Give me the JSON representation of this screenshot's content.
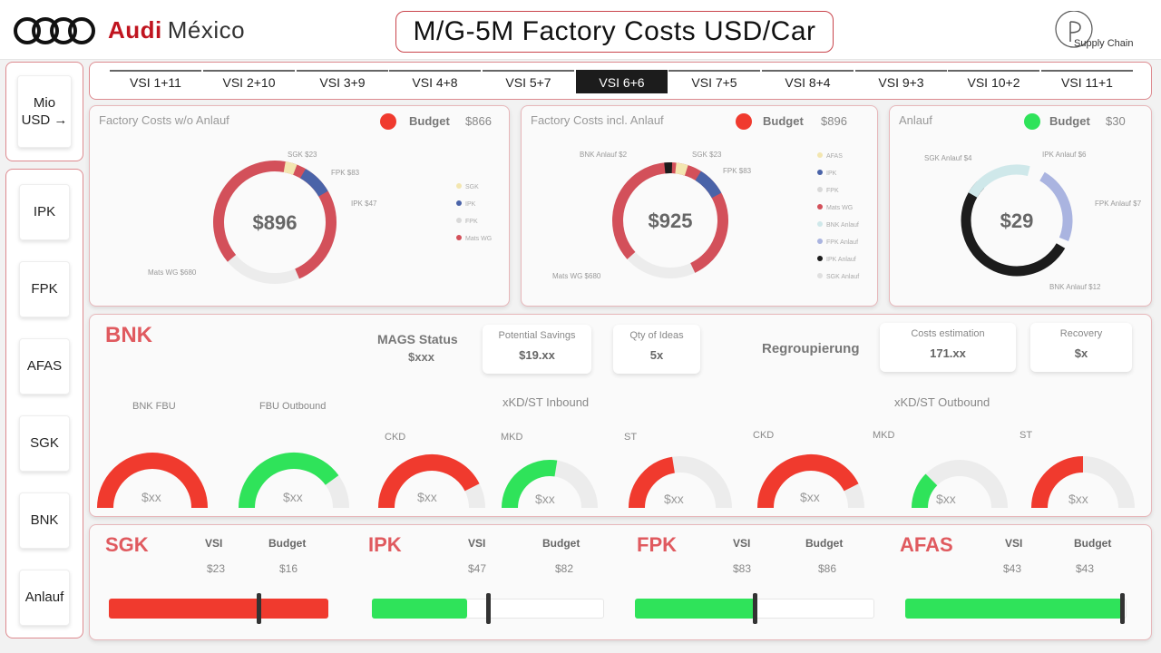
{
  "header": {
    "brand_audi": "Audi",
    "brand_location": "México",
    "title": "M/G-5M Factory Costs USD/Car",
    "logo_text": "Supply Chain"
  },
  "unit_toggle": {
    "label": "Mio USD →"
  },
  "nav": {
    "items": [
      "IPK",
      "FPK",
      "AFAS",
      "SGK",
      "BNK",
      "Anlauf"
    ]
  },
  "tabs": {
    "items": [
      "VSI 1+11",
      "VSI 2+10",
      "VSI 3+9",
      "VSI 4+8",
      "VSI 5+7",
      "VSI 6+6",
      "VSI 7+5",
      "VSI 8+4",
      "VSI 9+3",
      "VSI 10+2",
      "VSI 11+1"
    ],
    "active": "VSI 6+6"
  },
  "colors": {
    "accent_red": "#c0141f",
    "status_red": "#f03a2e",
    "status_green": "#2fe35a",
    "donut_red": "#d3505a",
    "donut_blue": "#4a63a8",
    "donut_black": "#1c1c1c",
    "donut_lavender": "#aab4e0",
    "donut_teal": "#cfe8ea"
  },
  "panels": {
    "factory_costs_wo": {
      "title": "Factory Costs w/o Anlauf",
      "budget_label": "Budget",
      "budget_value": "$866",
      "status": "red",
      "center_value": "$896",
      "slice_labels": [
        "SGK $23",
        "FPK $83",
        "IPK $47",
        "Mats WG $680"
      ],
      "legend": [
        "SGK",
        "IPK",
        "FPK",
        "Mats WG"
      ]
    },
    "factory_costs_incl": {
      "title": "Factory Costs incl. Anlauf",
      "budget_label": "Budget",
      "budget_value": "$896",
      "status": "red",
      "center_value": "$925",
      "slice_labels": [
        "BNK Anlauf $2",
        "SGK $23",
        "FPK $83",
        "Mats WG $680"
      ],
      "legend": [
        "AFAS",
        "IPK",
        "FPK",
        "Mats WG",
        "BNK Anlauf",
        "FPK Anlauf",
        "IPK Anlauf",
        "SGK Anlauf"
      ]
    },
    "anlauf": {
      "title": "Anlauf",
      "budget_label": "Budget",
      "budget_value": "$30",
      "status": "green",
      "center_value": "$29",
      "slice_labels": [
        "SGK Anlauf $4",
        "IPK Anlauf $6",
        "FPK Anlauf $7",
        "BNK Anlauf $12"
      ]
    }
  },
  "bnk": {
    "title": "BNK",
    "status_title": "MAGS Status",
    "status_value": "$xxx",
    "cards": [
      {
        "label": "Potential Savings",
        "value": "$19.xx"
      },
      {
        "label": "Qty of Ideas",
        "value": "5x"
      },
      {
        "label": "Costs estimation",
        "value": "171.xx"
      },
      {
        "label": "Recovery",
        "value": "$x"
      }
    ],
    "regrouping_label": "Regroupierung",
    "inbound_header": "xKD/ST Inbound",
    "outbound_header": "xKD/ST Outbound",
    "gauges_left": [
      {
        "label": "BNK FBU",
        "value": "$xx",
        "fraction": 1.0,
        "color": "red"
      },
      {
        "label": "FBU Outbound",
        "value": "$xx",
        "fraction": 0.8,
        "color": "green"
      }
    ],
    "gauges_inbound": [
      {
        "label": "CKD",
        "value": "$xx",
        "fraction": 0.85,
        "color": "red"
      },
      {
        "label": "MKD",
        "value": "$xx",
        "fraction": 0.55,
        "color": "green"
      },
      {
        "label": "ST",
        "value": "$xx",
        "fraction": 0.45,
        "color": "red"
      }
    ],
    "gauges_outbound": [
      {
        "label": "CKD",
        "value": "$xx",
        "fraction": 0.85,
        "color": "red"
      },
      {
        "label": "MKD",
        "value": "$xx",
        "fraction": 0.25,
        "color": "green"
      },
      {
        "label": "ST",
        "value": "$xx",
        "fraction": 0.5,
        "color": "red"
      }
    ]
  },
  "kpis": [
    {
      "title": "SGK",
      "vsi_label": "VSI",
      "budget_label": "Budget",
      "vsi_value": "$23",
      "budget_value": "$16",
      "fill": 1.0,
      "marker": 0.68,
      "color": "red"
    },
    {
      "title": "IPK",
      "vsi_label": "VSI",
      "budget_label": "Budget",
      "vsi_value": "$47",
      "budget_value": "$82",
      "fill": 0.41,
      "marker": 0.5,
      "color": "green"
    },
    {
      "title": "FPK",
      "vsi_label": "VSI",
      "budget_label": "Budget",
      "vsi_value": "$83",
      "budget_value": "$86",
      "fill": 0.5,
      "marker": 0.5,
      "color": "green"
    },
    {
      "title": "AFAS",
      "vsi_label": "VSI",
      "budget_label": "Budget",
      "vsi_value": "$43",
      "budget_value": "$43",
      "fill": 0.98,
      "marker": 0.98,
      "color": "green"
    }
  ]
}
